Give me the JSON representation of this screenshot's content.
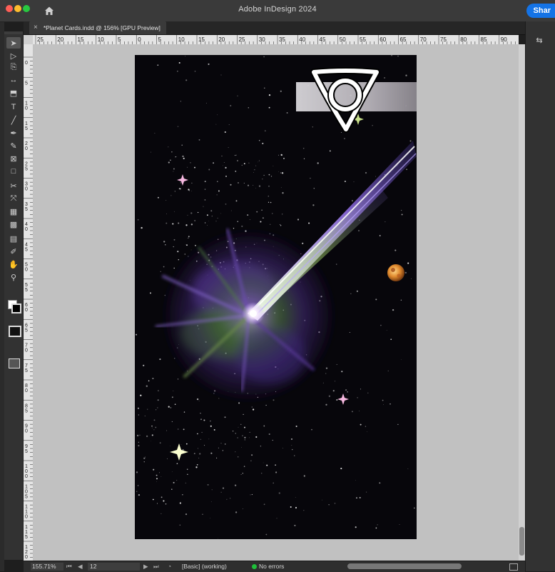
{
  "window": {
    "title": "Adobe InDesign 2024",
    "share_label": "Shar"
  },
  "document": {
    "tab_label": "*Planet Cards.indd @ 156% [GPU Preview]"
  },
  "ruler": {
    "h_labels": [
      "25",
      "20",
      "15",
      "10",
      "5",
      "0",
      "5",
      "10",
      "15",
      "20",
      "25",
      "30",
      "35",
      "40",
      "45",
      "50",
      "55",
      "60",
      "65",
      "70",
      "75",
      "80",
      "85",
      "90"
    ],
    "v_labels": [
      "0",
      "5",
      "10",
      "15",
      "20",
      "25",
      "30",
      "35",
      "40",
      "45",
      "50",
      "55",
      "60",
      "65",
      "70",
      "75",
      "80",
      "85",
      "90",
      "95",
      "100",
      "105",
      "110",
      "115",
      "120",
      "125",
      "130"
    ]
  },
  "tools": [
    {
      "name": "selection-tool",
      "glyph": "➤"
    },
    {
      "name": "direct-selection-tool",
      "glyph": "▷"
    },
    {
      "name": "page-tool",
      "glyph": "⎘"
    },
    {
      "name": "gap-tool",
      "glyph": "↔"
    },
    {
      "name": "content-collector-tool",
      "glyph": "⬒"
    },
    {
      "name": "type-tool",
      "glyph": "T"
    },
    {
      "name": "line-tool",
      "glyph": "╱"
    },
    {
      "name": "pen-tool",
      "glyph": "✒"
    },
    {
      "name": "pencil-tool",
      "glyph": "✎"
    },
    {
      "name": "rectangle-frame-tool",
      "glyph": "⊠"
    },
    {
      "name": "rectangle-tool",
      "glyph": "□"
    },
    {
      "name": "scissors-tool",
      "glyph": "✂"
    },
    {
      "name": "free-transform-tool",
      "glyph": "⤧"
    },
    {
      "name": "gradient-tool",
      "glyph": "▦"
    },
    {
      "name": "gradient-feather-tool",
      "glyph": "▩"
    },
    {
      "name": "note-tool",
      "glyph": "▤"
    },
    {
      "name": "eyedropper-tool",
      "glyph": "✐"
    },
    {
      "name": "hand-tool",
      "glyph": "✋"
    },
    {
      "name": "zoom-tool",
      "glyph": "⚲"
    }
  ],
  "status": {
    "zoom": "155.71%",
    "page": "12",
    "preflight_profile": "[Basic] (working)",
    "errors": "No errors"
  },
  "colors": {
    "accent": "#1473e6",
    "status_ok": "#1fbf3a",
    "pasteboard": "#c1c1c1"
  }
}
